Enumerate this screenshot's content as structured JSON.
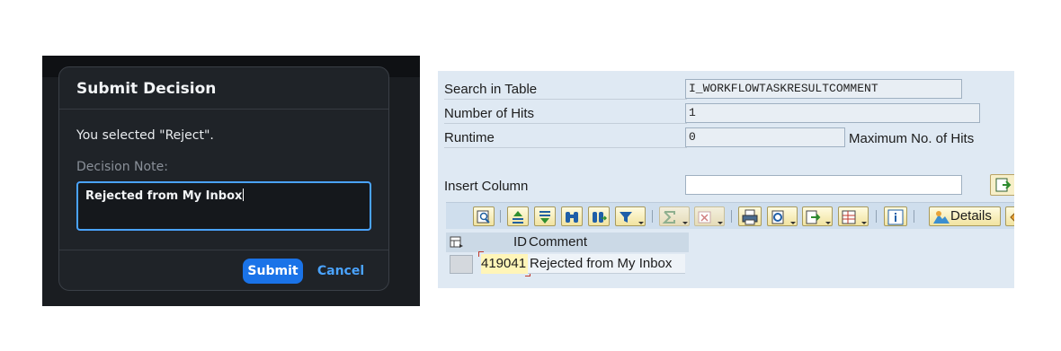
{
  "dialog": {
    "title": "Submit Decision",
    "message": "You selected \"Reject\".",
    "note_label": "Decision Note:",
    "note_value": "Rejected from My Inbox",
    "submit_label": "Submit",
    "cancel_label": "Cancel",
    "accent_color": "#1a73e8"
  },
  "sap": {
    "search_table_label": "Search in Table",
    "search_table_value": "I_WORKFLOWTASKRESULTCOMMENT",
    "hits_label": "Number of Hits",
    "hits_value": "1",
    "runtime_label": "Runtime",
    "runtime_value": "0",
    "max_hits_label": "Maximum No. of Hits",
    "insert_column_label": "Insert Column",
    "insert_column_value": "",
    "toolbar": {
      "icons": [
        "magnify-icon",
        "sort-ascending-icon",
        "sort-descending-icon",
        "find-icon",
        "find-next-icon",
        "filter-icon",
        "sum-icon",
        "subtotal-icon",
        "print-icon",
        "views-icon",
        "export-icon",
        "layout-icon",
        "info-icon",
        "details-icon",
        "more-icon"
      ],
      "details_label": "Details"
    },
    "grid": {
      "columns": [
        "ID",
        "Comment"
      ],
      "rows": [
        {
          "id": "419041",
          "comment": "Rejected from My Inbox"
        }
      ]
    }
  }
}
